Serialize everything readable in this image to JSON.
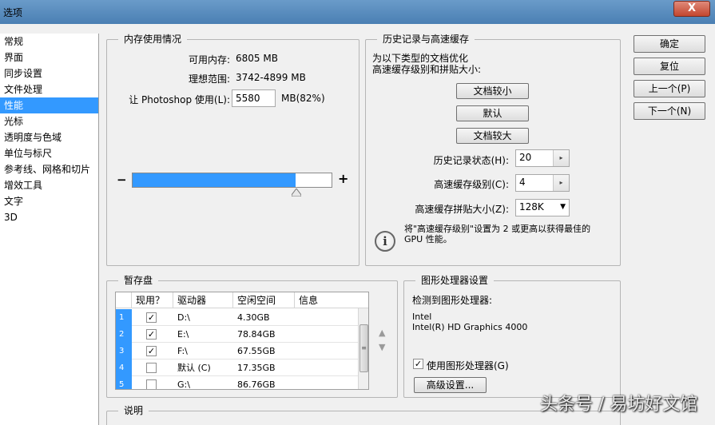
{
  "window": {
    "title": "选项",
    "close_glyph": "X"
  },
  "sidebar": {
    "items": [
      {
        "label": "常规"
      },
      {
        "label": "界面"
      },
      {
        "label": "同步设置"
      },
      {
        "label": "文件处理"
      },
      {
        "label": "性能"
      },
      {
        "label": "光标"
      },
      {
        "label": "透明度与色域"
      },
      {
        "label": "单位与标尺"
      },
      {
        "label": "参考线、网格和切片"
      },
      {
        "label": "增效工具"
      },
      {
        "label": "文字"
      },
      {
        "label": "3D"
      }
    ],
    "selected_index": 4
  },
  "memory": {
    "legend": "内存使用情况",
    "available_label": "可用内存:",
    "available_value": "6805 MB",
    "ideal_label": "理想范围:",
    "ideal_value": "3742-4899 MB",
    "let_label": "让 Photoshop 使用(L):",
    "let_value": "5580",
    "unit_label": "MB(82%)",
    "usage_percent": 82,
    "minus": "−",
    "plus": "+"
  },
  "history": {
    "legend": "历史记录与高速缓存",
    "desc": "为以下类型的文档优化\n高速缓存级别和拼贴大小:",
    "btn_small": "文档较小",
    "btn_default": "默认",
    "btn_large": "文档较大",
    "states_label": "历史记录状态(H):",
    "states_value": "20",
    "cache_levels_label": "高速缓存级别(C):",
    "cache_levels_value": "4",
    "tile_label": "高速缓存拼贴大小(Z):",
    "tile_value": "128K",
    "note": "将\"高速缓存级别\"设置为 2 或更高以获得最佳的\nGPU 性能。"
  },
  "buttons": {
    "ok": "确定",
    "reset": "复位",
    "prev": "上一个(P)",
    "next": "下一个(N)"
  },
  "scratch": {
    "legend": "暂存盘",
    "headers": [
      "现用？",
      "驱动器",
      "空闲空间",
      "信息"
    ],
    "rows": [
      {
        "num": "1",
        "active": true,
        "drive": "D:\\",
        "free": "4.30GB",
        "info": ""
      },
      {
        "num": "2",
        "active": true,
        "drive": "E:\\",
        "free": "78.84GB",
        "info": ""
      },
      {
        "num": "3",
        "active": true,
        "drive": "F:\\",
        "free": "67.55GB",
        "info": ""
      },
      {
        "num": "4",
        "active": false,
        "drive": "默认 (C)",
        "free": "17.35GB",
        "info": ""
      },
      {
        "num": "5",
        "active": false,
        "drive": "G:\\",
        "free": "86.76GB",
        "info": ""
      }
    ]
  },
  "gpu": {
    "legend": "图形处理器设置",
    "detected_label": "检测到图形处理器:",
    "vendor": "Intel",
    "model": "Intel(R) HD Graphics 4000",
    "use_label": "使用图形处理器(G)",
    "use_checked": true,
    "advanced_button": "高级设置..."
  },
  "description": {
    "legend": "说明"
  },
  "watermark": "头条号 / 易坊好文馆",
  "icons": {
    "check": "✓",
    "info": "i",
    "up": "▲",
    "down": "▼",
    "dropdown": "▼",
    "spin": "▸"
  }
}
